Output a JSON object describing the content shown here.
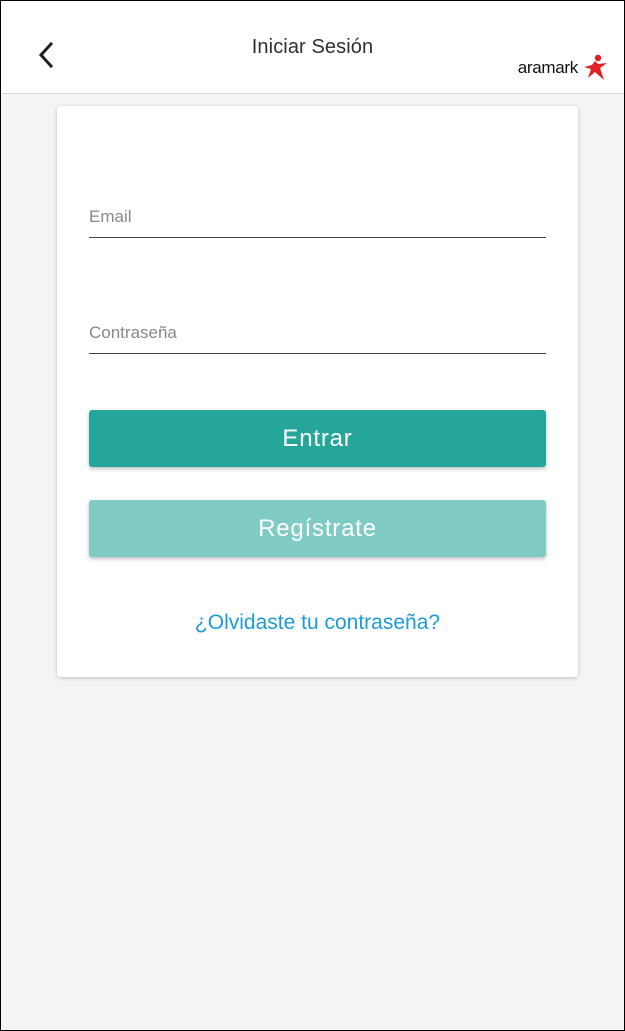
{
  "header": {
    "title": "Iniciar Sesión",
    "back_icon": "chevron-left-icon",
    "logo_text": "aramark",
    "logo_icon": "aramark-star-icon",
    "brand_color": "#e21e26"
  },
  "form": {
    "email_placeholder": "Email",
    "password_placeholder": "Contraseña",
    "login_label": "Entrar",
    "register_label": "Regístrate",
    "forgot_label": "¿Olvidaste tu contraseña?"
  },
  "colors": {
    "primary": "#26a69a",
    "secondary": "#80cbc4",
    "link": "#1e9bd7",
    "background": "#f4f4f4",
    "card": "#ffffff"
  }
}
